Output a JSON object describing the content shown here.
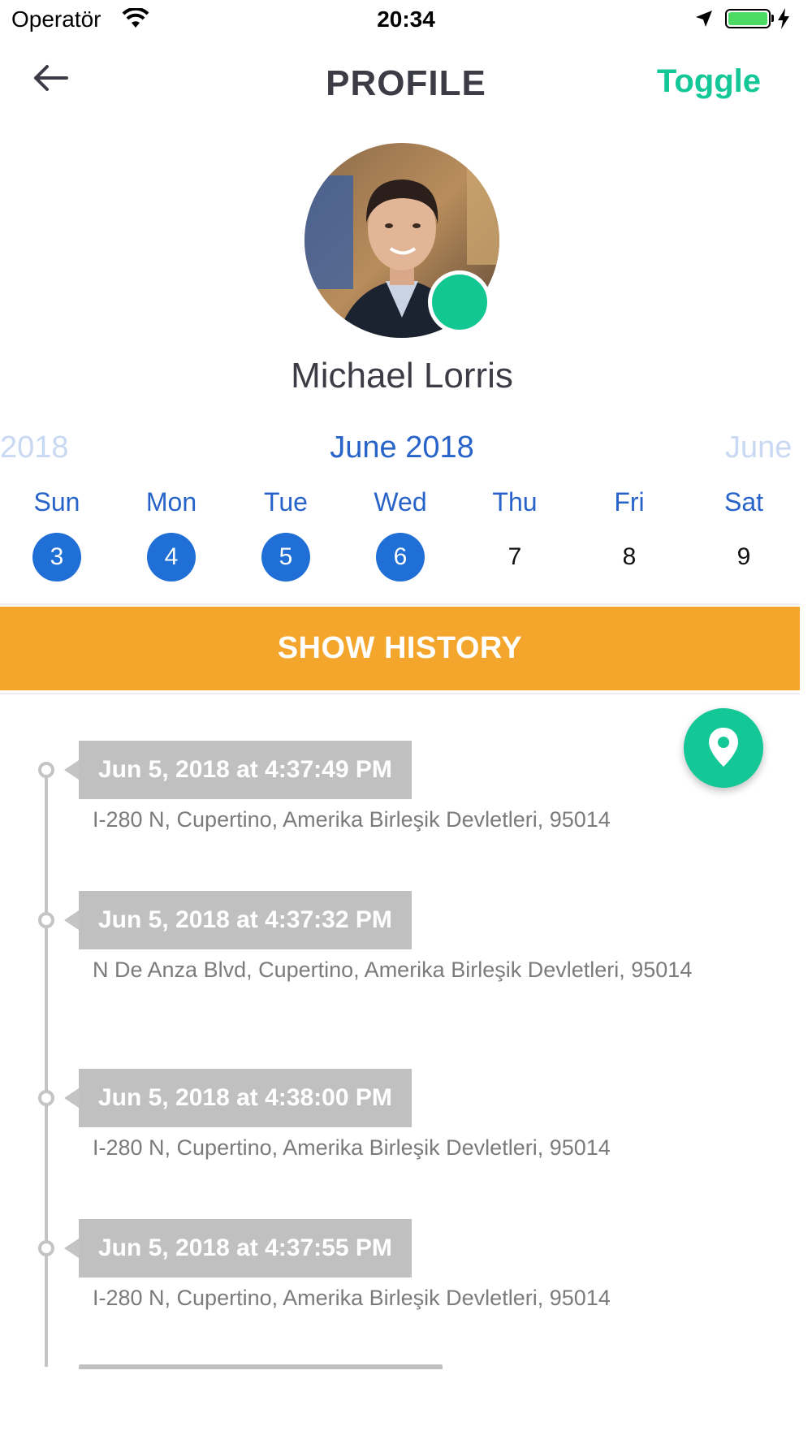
{
  "status_bar": {
    "carrier": "Operatör",
    "time": "20:34"
  },
  "nav": {
    "title": "PROFILE",
    "toggle_label": "Toggle"
  },
  "profile": {
    "name": "Michael Lorris",
    "online_color": "#13c793"
  },
  "calendar": {
    "prev_month": "2018",
    "current_month": "June 2018",
    "next_month": "June",
    "weekdays": [
      "Sun",
      "Mon",
      "Tue",
      "Wed",
      "Thu",
      "Fri",
      "Sat"
    ],
    "days": [
      "3",
      "4",
      "5",
      "6",
      "7",
      "8",
      "9"
    ],
    "selected_days": [
      "3",
      "4",
      "5",
      "6"
    ],
    "accent_color": "#1f6fd6"
  },
  "history_button": {
    "label": "SHOW HISTORY",
    "color": "#f4a52c"
  },
  "history": [
    {
      "time": "Jun 5, 2018 at 4:37:49 PM",
      "address": "I-280 N, Cupertino, Amerika Birleşik Devletleri, 95014"
    },
    {
      "time": "Jun 5, 2018 at 4:37:32 PM",
      "address": "N De Anza Blvd, Cupertino, Amerika Birleşik Devletleri, 95014"
    },
    {
      "time": "Jun 5, 2018 at 4:38:00 PM",
      "address": "I-280 N, Cupertino, Amerika Birleşik Devletleri, 95014"
    },
    {
      "time": "Jun 5, 2018 at 4:37:55 PM",
      "address": "I-280 N, Cupertino, Amerika Birleşik Devletleri, 95014"
    }
  ],
  "icons": {
    "back": "arrow-left-icon",
    "fab": "location-pin-icon"
  }
}
